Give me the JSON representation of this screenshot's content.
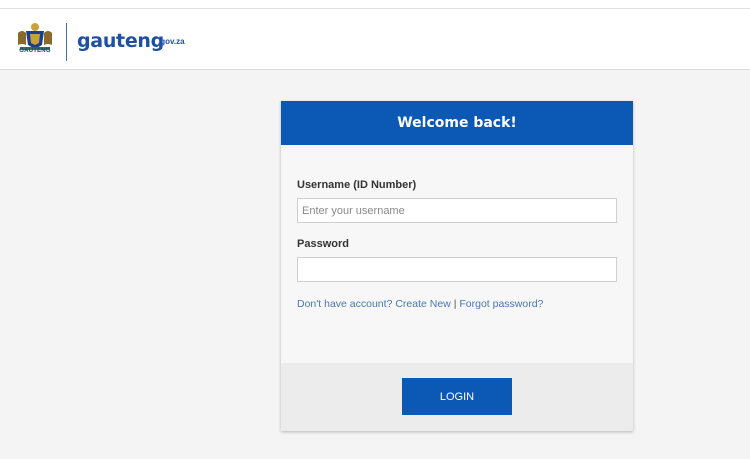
{
  "header": {
    "crest_label": "GAUTENG",
    "brand_name": "gauteng",
    "brand_suffix": ".gov.za"
  },
  "login": {
    "title": "Welcome back!",
    "username_label": "Username (ID Number)",
    "username_placeholder": "Enter your username",
    "username_value": "",
    "password_label": "Password",
    "password_value": "",
    "no_account_text": "Don't have account?",
    "create_new_link": "Create New",
    "separator": "|",
    "forgot_link": "Forgot password?",
    "login_button": "LOGIN"
  },
  "colors": {
    "primary": "#0b58b5",
    "link": "#4a77b4",
    "brand": "#1f4fa0"
  }
}
